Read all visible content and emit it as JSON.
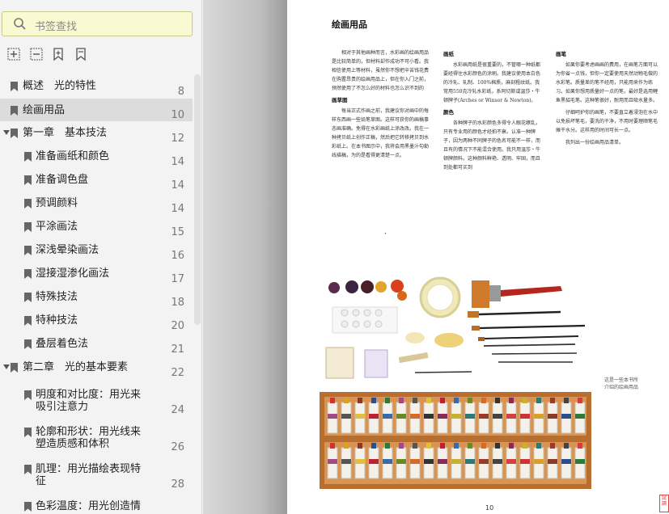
{
  "sidebar": {
    "search": {
      "placeholder": "书签查找"
    },
    "bookmarks": [
      {
        "label": "概述　光的特性",
        "page": "8"
      },
      {
        "label": "绘画用品",
        "page": "10"
      },
      {
        "label": "第一章　基本技法",
        "page": "12"
      },
      {
        "label": "准备画纸和颜色",
        "page": "14"
      },
      {
        "label": "准备调色盘",
        "page": "14"
      },
      {
        "label": "预调颜料",
        "page": "14"
      },
      {
        "label": "平涂画法",
        "page": "15"
      },
      {
        "label": "深浅晕染画法",
        "page": "16"
      },
      {
        "label": "湿接湿渗化画法",
        "page": "17"
      },
      {
        "label": "特殊技法",
        "page": "18"
      },
      {
        "label": "特种技法",
        "page": "20"
      },
      {
        "label": "叠层着色法",
        "page": "21"
      },
      {
        "label": "第二章　光的基本要素",
        "page": "22"
      },
      {
        "label": "明度和对比度：用光来吸引注意力",
        "page": "24"
      },
      {
        "label": "轮廓和形状：用光线来塑造质感和体积",
        "page": "26"
      },
      {
        "label": "肌理：用光描绘表现特征",
        "page": "28"
      },
      {
        "label": "色彩温度：用光创造情",
        "page": ""
      }
    ]
  },
  "document": {
    "title": "绘画用品",
    "col1": {
      "p1": "相对于其他画种而言，水彩画的绘画用品是比较简单的，但材料却作成功不可小看。我相信使用上等材料，虽然你不想把辛苦钱花费在购置昂贵的绘画用品上，但在你入门之前，预然使用了不怎么好的材料也怎么识不到的",
      "head": "画草图",
      "p2": "每当正式作画之前，我建议你对画中的每样东西画一些铅笔草图。这样可获你的画稿事态画准确。免得在水彩画纸上涂改改。我在一种拷贝纸上创作正稿，然后把它转移拷贝到水彩纸上。在本书图示中，我将会用黑墨汁勾勒线描稿，为的是看得更清楚一点。"
    },
    "col2": {
      "head1": "画纸",
      "p1": "水彩画用纸是很重要的，不管哪一种纸都要经得住水彩颜色的涂刷。我建议使用本白色的冷轧、轧制、100%棉质，麻刻粗纹纸。我常用550克冷轧水彩纸，系阿切斯或温莎・牛顿牌子(Arches or Winsor & Newton)。",
      "head2": "颜色",
      "p2": "各种牌子的水彩颜色多得令人眼花缭乱，只有专业用的颜色才经拍不衰。认准一种牌子，因为两种不同牌子的色名可能不一样，而且有的情况下不能混合使用。我只用温莎・牛顿牌颜料。这种颜料鲜艳、透明、牢固，而且到处都可买到"
    },
    "col3": {
      "head": "画笔",
      "p1": "如果你要考虑画画的费用，在画笔方面可以为你省一点钱，但你一定要使用天然动物毛做的水彩笔。质量差的笔不经用，只能用来作为练习。如果你想用质量好一点的笔，最好是选用鲤鱼黑貂毛笔。这种笔很好，耐用而且吸水量多。",
      "p2": "仔细呵护你的画笔，不要直立着浸泡在水中以免损坏笔毛，要洗的干净，不用时要理顺笔毛摊干水分。这样用的时间可长一点。",
      "p3": "我列出一份绘画用品清单。"
    },
    "dot": "・",
    "caption": "这是一些本书所介绍的绘画用品",
    "page_number": "10",
    "stamp_text": "試讀"
  }
}
